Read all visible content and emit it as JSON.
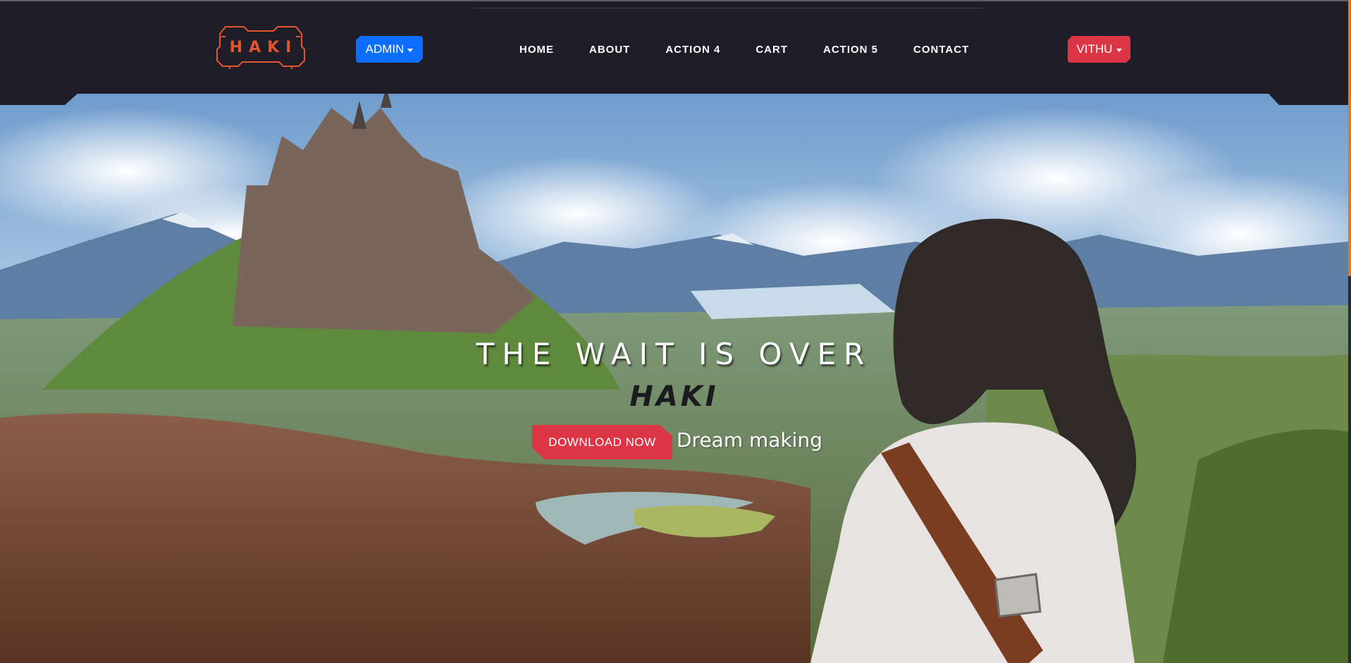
{
  "brand": {
    "logo_text": "HAKI"
  },
  "header": {
    "admin_label": "ADMIN",
    "nav": [
      {
        "label": "HOME"
      },
      {
        "label": "ABOUT"
      },
      {
        "label": "ACTION 4"
      },
      {
        "label": "CART"
      },
      {
        "label": "ACTION 5"
      },
      {
        "label": "CONTACT"
      }
    ],
    "user_label": "VITHU"
  },
  "hero": {
    "tagline": "THE WAIT IS OVER",
    "brand_word": "HAKI",
    "download_label": "DOWNLOAD NOW",
    "subtext": "Dream making"
  },
  "colors": {
    "header_bg": "#1f1e28",
    "primary": "#0d6efd",
    "danger": "#dc3545",
    "logo_accent": "#e2542d",
    "scroll_thumb": "#e0781f"
  },
  "icons": {
    "admin_caret": "caret-down-icon",
    "user_caret": "caret-down-icon"
  }
}
